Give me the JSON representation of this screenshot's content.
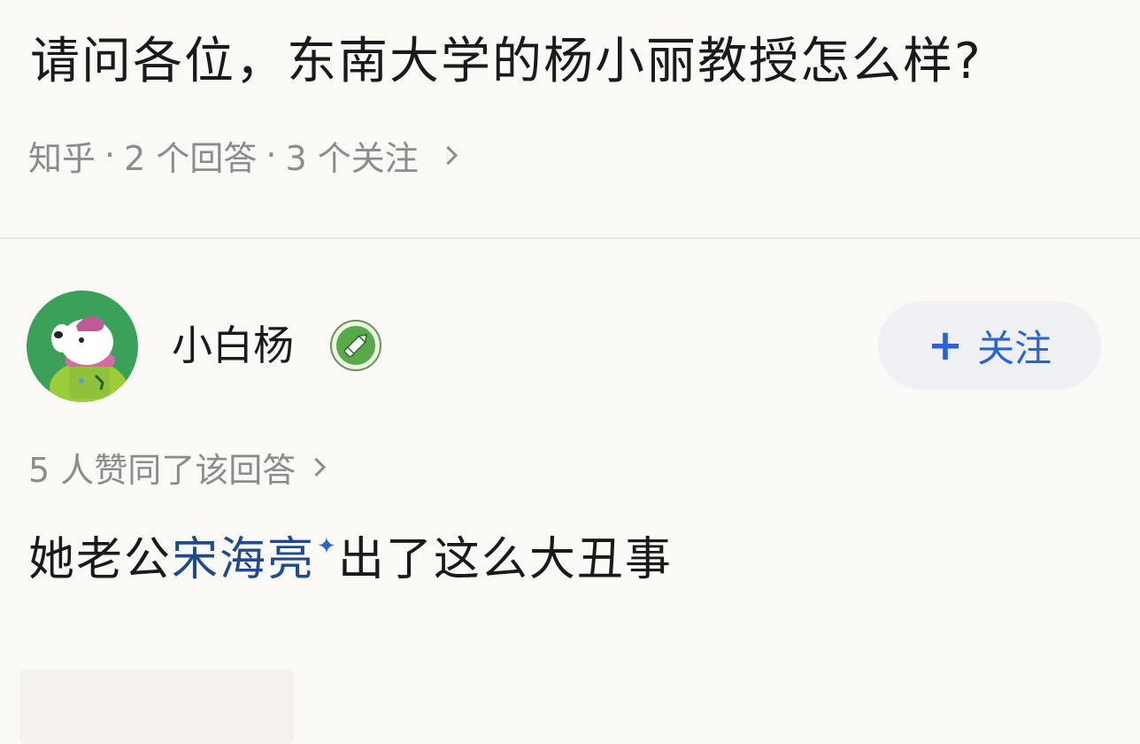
{
  "question": {
    "title": "请问各位，东南大学的杨小丽教授怎么样?"
  },
  "meta": {
    "source": "知乎",
    "separator": "·",
    "answers": "2 个回答",
    "followers": "3 个关注"
  },
  "author": {
    "name": "小白杨",
    "avatar_icon": "cartoon-dog-avatar-icon",
    "badge_icon": "pencil-badge-icon"
  },
  "follow_button": {
    "plus": "+",
    "label": "关注"
  },
  "answer": {
    "voters": "5 人赞同了该回答",
    "text_before": "她老公",
    "link_text": "宋海亮",
    "spark": "✦",
    "text_after": "出了这么大丑事"
  },
  "colors": {
    "background": "#fbf9f6",
    "primary_text": "#1a1a1a",
    "secondary_text": "#8c8c8c",
    "link": "#1f4a8c",
    "accent_blue": "#2a63d8",
    "button_bg": "#eef0f4",
    "badge_green": "#4caf50"
  }
}
